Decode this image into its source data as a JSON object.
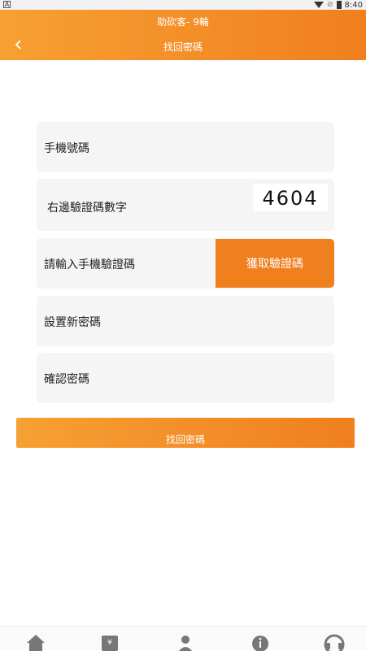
{
  "status_bar": {
    "time": "8:40",
    "app_indicator": "A"
  },
  "header": {
    "app_title": "助砍客- 9輪",
    "page_title": "找回密碼",
    "back_icon": "chevron-left-icon"
  },
  "form": {
    "phone_label": "手機號碼",
    "captcha_label": "右邊驗證碼數字",
    "captcha_text": "4604",
    "sms_code_label": "請輸入手機驗證碼",
    "get_code_button": "獲取驗證碼",
    "new_password_label": "設置新密碼",
    "confirm_password_label": "確認密碼"
  },
  "submit_label": "找回密碼",
  "colors": {
    "accent": "#f07f1e",
    "accent_light": "#f7a033",
    "field_bg": "#f5f5f5"
  },
  "bottom_nav": {
    "icons": [
      "home-icon",
      "store-icon",
      "profile-icon",
      "info-icon",
      "support-icon"
    ]
  }
}
